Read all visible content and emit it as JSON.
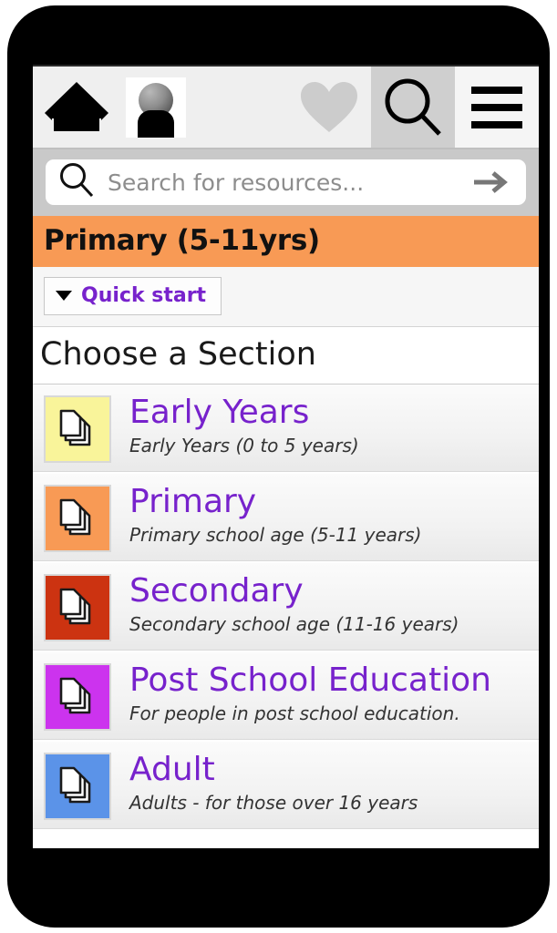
{
  "topbar": {
    "home_label": "home-icon",
    "avatar_label": "account-avatar",
    "favourites_label": "favourites-heart-icon",
    "search_label": "search-magnifier-icon",
    "menu_label": "hamburger-menu-icon"
  },
  "search": {
    "placeholder": "Search for resources...",
    "value": "",
    "submit_label": "submit-arrow"
  },
  "banner": {
    "title": "Primary (5-11yrs)",
    "color": "#f89a55"
  },
  "quickstart": {
    "label": "Quick start",
    "color": "#7722cc"
  },
  "section": {
    "heading": "Choose a Section",
    "items": [
      {
        "title": "Early Years",
        "desc": "Early Years (0 to 5 years)",
        "color": "#f9f49a",
        "icon": "documents-stack-icon"
      },
      {
        "title": "Primary",
        "desc": "Primary school age (5-11 years)",
        "color": "#f89a55",
        "icon": "documents-stack-icon"
      },
      {
        "title": "Secondary",
        "desc": "Secondary school age (11-16 years)",
        "color": "#cc3311",
        "icon": "documents-stack-icon"
      },
      {
        "title": "Post School Education",
        "desc": "For people in post school education.",
        "color": "#cc33ee",
        "icon": "documents-stack-icon"
      },
      {
        "title": "Adult",
        "desc": "Adults - for those over 16 years",
        "color": "#5b93e8",
        "icon": "documents-stack-icon"
      }
    ]
  }
}
